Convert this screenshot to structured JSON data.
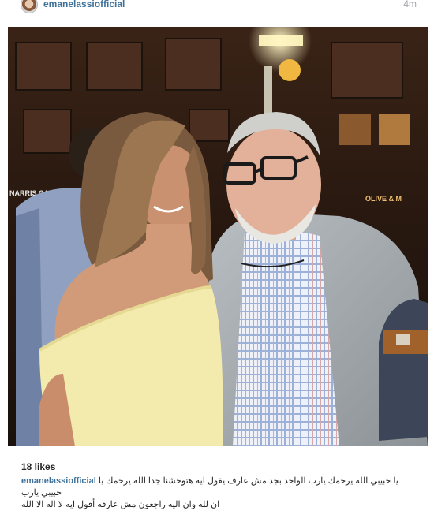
{
  "post": {
    "username": "emanelassiofficial",
    "timestamp": "4m",
    "likes": "18 likes",
    "caption_user": "emanelassiofficial",
    "caption_line1": "يا حبيبي الله يرحمك يارب الواحد بجد مش عارف يقول ايه هتوحشنا جدا الله يرحمك يا حبيبي يارب",
    "caption_line2": "ان لله وان اليه راجعون مش عارفه أقول ايه لا اله الا الله"
  },
  "photo": {
    "signs": {
      "left": "NARRIS CAFE",
      "right": "OLIVE & M"
    },
    "alt": "photo"
  },
  "colors": {
    "link": "#3f729b",
    "muted": "#a5a7aa",
    "text": "#262626"
  }
}
